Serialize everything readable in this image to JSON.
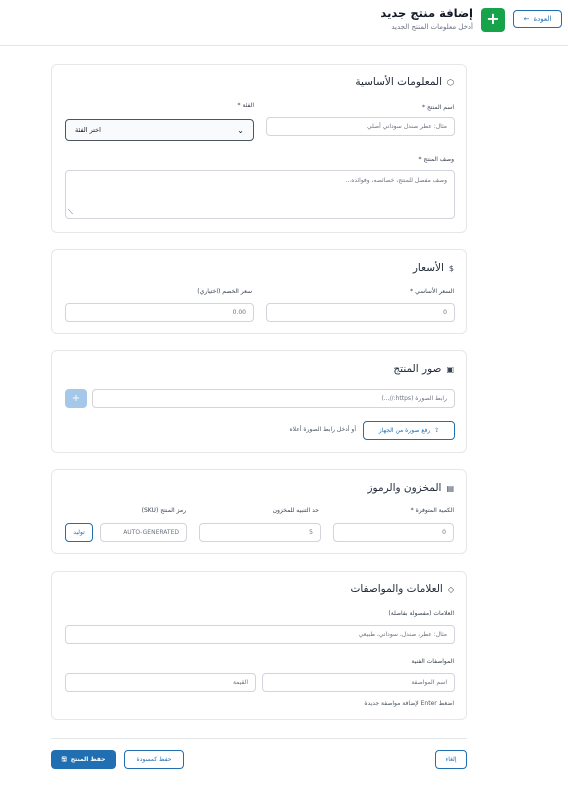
{
  "header": {
    "back_label": "العودة",
    "title": "إضافة منتج جديد",
    "subtitle": "أدخل معلومات المنتج الجديد"
  },
  "basic": {
    "title": "المعلومات الأساسية",
    "name_label": "اسم المنتج *",
    "name_placeholder": "مثال: عطر صندل سوداني أصلي",
    "category_label": "الفئة *",
    "category_value": "اختر الفئة",
    "desc_label": "وصف المنتج *",
    "desc_placeholder": "وصف مفصل للمنتج، خصائصه، وفوائده..."
  },
  "pricing": {
    "title": "الأسعار",
    "base_label": "السعر الأساسي *",
    "base_value": "0",
    "discount_label": "سعر الخصم (اختياري)",
    "discount_value": "0.00"
  },
  "images": {
    "title": "صور المنتج",
    "url_placeholder": "رابط الصورة (https://...)",
    "add_label": "+",
    "upload_label": "رفع صورة من الجهاز",
    "upload_hint": "أو أدخل رابط الصورة أعلاه"
  },
  "inventory": {
    "title": "المخزون والرموز",
    "qty_label": "الكمية المتوفرة *",
    "qty_value": "0",
    "threshold_label": "حد التنبيه للمخزون",
    "threshold_value": "5",
    "sku_label": "رمز المنتج (SKU)",
    "sku_placeholder": "AUTO-GENERATED",
    "generate_label": "توليد"
  },
  "tags": {
    "title": "العلامات والمواصفات",
    "tags_label": "العلامات (مفصولة بفاصلة)",
    "tags_placeholder": "مثال: عطر، صندل، سوداني، طبيعي",
    "specs_label": "المواصفات الفنية",
    "spec_name_placeholder": "اسم المواصفة",
    "spec_value_placeholder": "القيمة",
    "specs_hint": "اضغط Enter لإضافة مواصفة جديدة"
  },
  "footer": {
    "cancel_label": "إلغاء",
    "draft_label": "حفظ كمسودة",
    "save_label": "حفظ المنتج"
  },
  "colors": {
    "primary": "#1f6fb2",
    "success": "#16a34a"
  }
}
